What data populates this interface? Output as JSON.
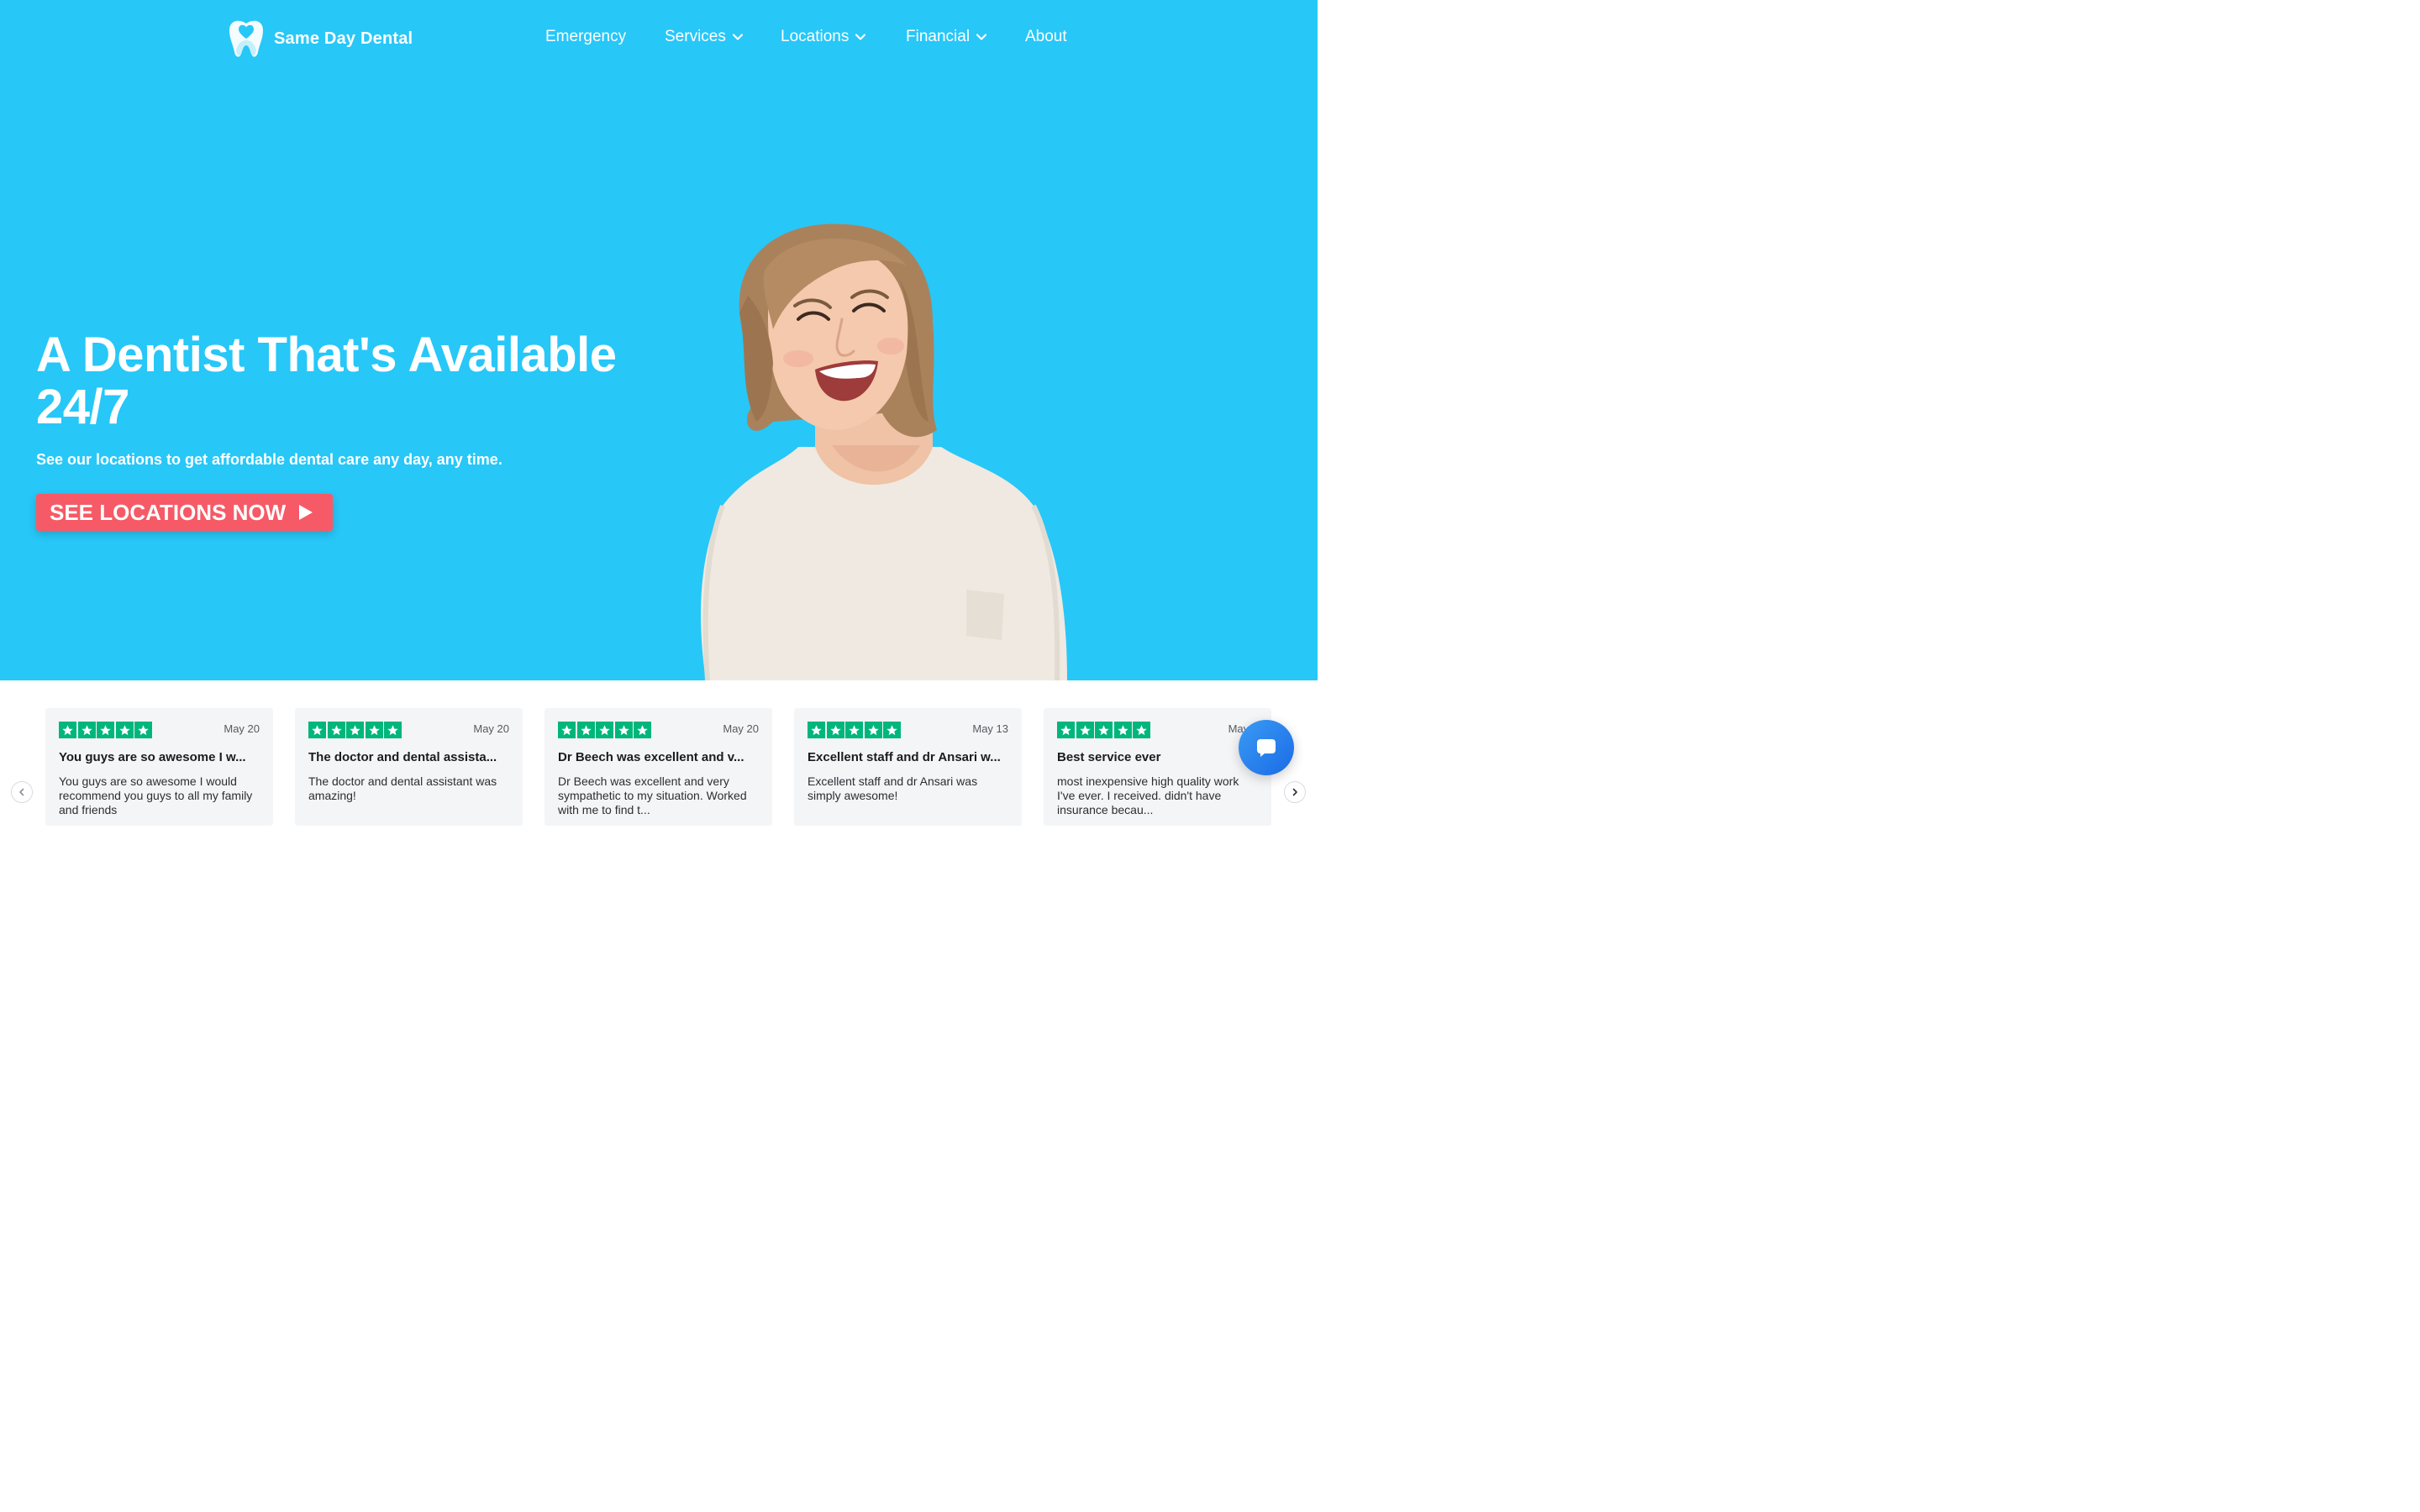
{
  "brand": {
    "name": "Same Day Dental",
    "logo_icon": "tooth-heart-icon"
  },
  "nav": {
    "items": [
      {
        "label": "Emergency",
        "has_dropdown": false
      },
      {
        "label": "Services",
        "has_dropdown": true
      },
      {
        "label": "Locations",
        "has_dropdown": true
      },
      {
        "label": "Financial",
        "has_dropdown": true
      },
      {
        "label": "About",
        "has_dropdown": false
      }
    ]
  },
  "hero": {
    "title": "A Dentist That's Available 24/7",
    "subtitle": "See our locations to get affordable dental care any day, any time.",
    "cta_label": "SEE LOCATIONS NOW",
    "background_color": "#27c7f8",
    "cta_color": "#f65a66"
  },
  "reviews": {
    "star_color": "#00b67a",
    "items": [
      {
        "rating": 5,
        "date": "May 20",
        "title": "You guys are so awesome I w...",
        "body": "You guys are so awesome I would recommend you guys to all my family and friends"
      },
      {
        "rating": 5,
        "date": "May 20",
        "title": "The doctor and dental assista...",
        "body": "The doctor and dental assistant was amazing!"
      },
      {
        "rating": 5,
        "date": "May 20",
        "title": "Dr Beech was excellent and v...",
        "body": "Dr Beech was excellent and very sympathetic to my situation. Worked with me to find t..."
      },
      {
        "rating": 5,
        "date": "May 13",
        "title": "Excellent staff and dr Ansari w...",
        "body": "Excellent staff and dr Ansari was simply awesome!"
      },
      {
        "rating": 5,
        "date": "May 1",
        "title": "Best service ever",
        "body": "most inexpensive high quality work I've ever. I received. didn't have insurance becau..."
      }
    ]
  },
  "carousel": {
    "prev_icon": "chevron-left-icon",
    "next_icon": "chevron-right-icon"
  },
  "chat": {
    "icon": "chat-bubble-icon",
    "color": "#1a6be6"
  }
}
